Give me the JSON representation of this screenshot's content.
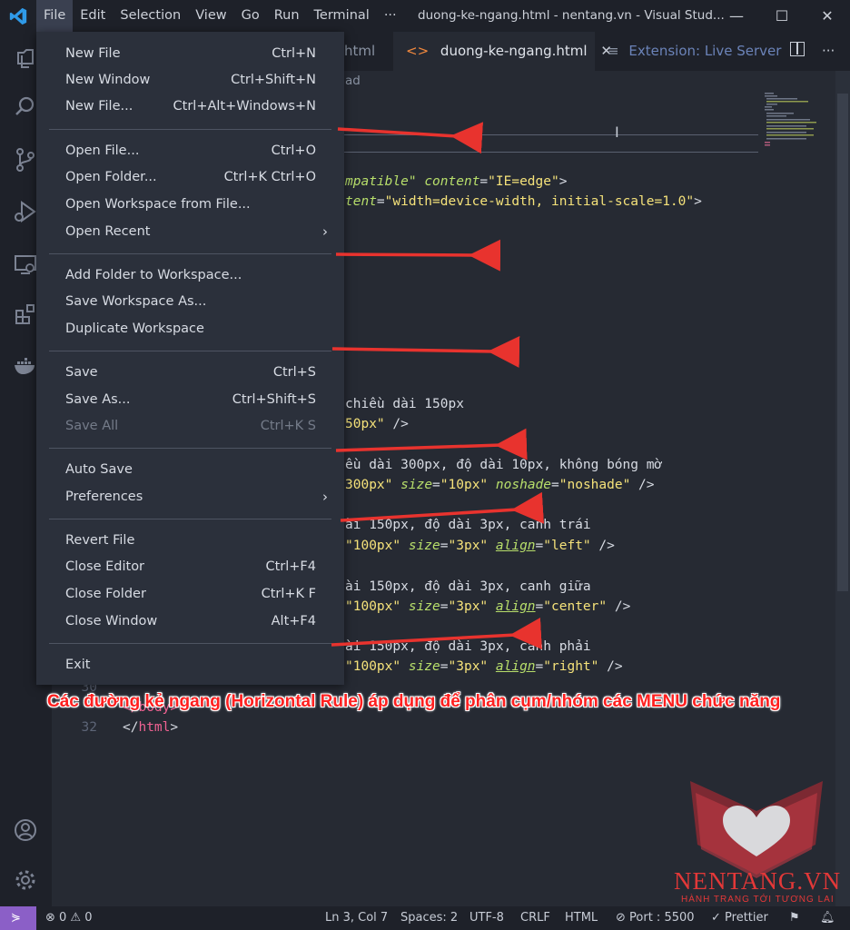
{
  "window": {
    "title": "duong-ke-ngang.html - nentang.vn - Visual Stud...",
    "controls": [
      "—",
      "☐",
      "✕"
    ]
  },
  "menubar": {
    "items": [
      "File",
      "Edit",
      "Selection",
      "View",
      "Go",
      "Run",
      "Terminal",
      "···"
    ]
  },
  "tabs": [
    {
      "label": "html",
      "icon": "html-file-icon"
    },
    {
      "label": "duong-ke-ngang.html",
      "icon": "html-file-icon",
      "close": "✕"
    },
    {
      "label": "Extension: Live Server",
      "icon": "extension-preview-icon"
    }
  ],
  "breadcrumb": "ad",
  "file_menu": {
    "group1": [
      {
        "label": "New File",
        "shortcut": "Ctrl+N"
      },
      {
        "label": "New Window",
        "shortcut": "Ctrl+Shift+N"
      },
      {
        "label": "New File...",
        "shortcut": "Ctrl+Alt+Windows+N"
      }
    ],
    "group2": [
      {
        "label": "Open File...",
        "shortcut": "Ctrl+O"
      },
      {
        "label": "Open Folder...",
        "shortcut": "Ctrl+K Ctrl+O"
      },
      {
        "label": "Open Workspace from File...",
        "shortcut": ""
      },
      {
        "label": "Open Recent",
        "shortcut": "",
        "submenu": "›"
      }
    ],
    "group3": [
      {
        "label": "Add Folder to Workspace...",
        "shortcut": ""
      },
      {
        "label": "Save Workspace As...",
        "shortcut": ""
      },
      {
        "label": "Duplicate Workspace",
        "shortcut": ""
      }
    ],
    "group4": [
      {
        "label": "Save",
        "shortcut": "Ctrl+S"
      },
      {
        "label": "Save As...",
        "shortcut": "Ctrl+Shift+S"
      },
      {
        "label": "Save All",
        "shortcut": "Ctrl+K S",
        "disabled": true
      }
    ],
    "group5": [
      {
        "label": "Auto Save",
        "shortcut": ""
      },
      {
        "label": "Preferences",
        "shortcut": "",
        "submenu": "›"
      }
    ],
    "group6": [
      {
        "label": "Revert File",
        "shortcut": ""
      },
      {
        "label": "Close Editor",
        "shortcut": "Ctrl+F4"
      },
      {
        "label": "Close Folder",
        "shortcut": "Ctrl+K F"
      },
      {
        "label": "Close Window",
        "shortcut": "Alt+F4"
      }
    ],
    "group7": [
      {
        "label": "Exit",
        "shortcut": ""
      }
    ]
  },
  "code": {
    "line_a_attr1": "mpatible\"",
    "line_a_attr2": "content",
    "line_a_val": "\"IE=edge\"",
    "line_a_end": ">",
    "line_b_attr": "tent",
    "line_b_val": "\"width=device-width, initial-scale=1.0\"",
    "line_b_end": ">",
    "c1_comment": "chiều dài 150px",
    "c1_val": "50px\"",
    "c1_end": " />",
    "c2_comment": "ều dài 300px, độ dài 10px, không bóng mờ",
    "c2_v1": "300px\"",
    "c2_a2": "size",
    "c2_v2": "\"10px\"",
    "c2_a3": "noshade",
    "c2_v3": "\"noshade\"",
    "c2_end": " />",
    "c3_comment": "ài 150px, độ dài 3px, canh trái",
    "c3_v1": "\"100px\"",
    "c3_a2": "size",
    "c3_v2": "\"3px\"",
    "c3_a3": "align",
    "c3_v3": "\"left\"",
    "c3_end": " />",
    "c4_comment": "ài 150px, độ dài 3px, canh giữa",
    "c4_v1": "\"100px\"",
    "c4_a2": "size",
    "c4_v2": "\"3px\"",
    "c4_a3": "align",
    "c4_v3": "\"center\"",
    "c4_end": " />",
    "c5_comment": "ài 150px, độ dài 3px, canh phải",
    "c5_v1": "\"100px\"",
    "c5_a2": "size",
    "c5_v2": "\"3px\"",
    "c5_a3": "align",
    "c5_v3": "\"right\"",
    "c5_end": " />",
    "line30_num": "30",
    "line31_text": "</body>",
    "line32_num": "32",
    "line32_open": "</",
    "line32_tag": "html",
    "line32_close": ">"
  },
  "annotation": "Các đường kẻ ngang (Horizontal Rule) áp dụng để phân cụm/nhóm các MENU chức năng",
  "watermark": {
    "brand": "NENTANG.VN",
    "slogan": "HÀNH TRANG TỚI TƯƠNG LAI"
  },
  "status": {
    "problems": "⊗ 0 ⚠ 0",
    "position": "Ln 3, Col 7",
    "spaces": "Spaces: 2",
    "encoding": "UTF-8",
    "eol": "CRLF",
    "language": "HTML",
    "port": "Port : 5500",
    "prettier": "✓ Prettier"
  },
  "colors": {
    "accent_purple": "#8b5fc7",
    "annotation_red": "#ff1f1f",
    "arrow_red": "#e8332e",
    "vscode_blue": "#2f9ae8"
  }
}
